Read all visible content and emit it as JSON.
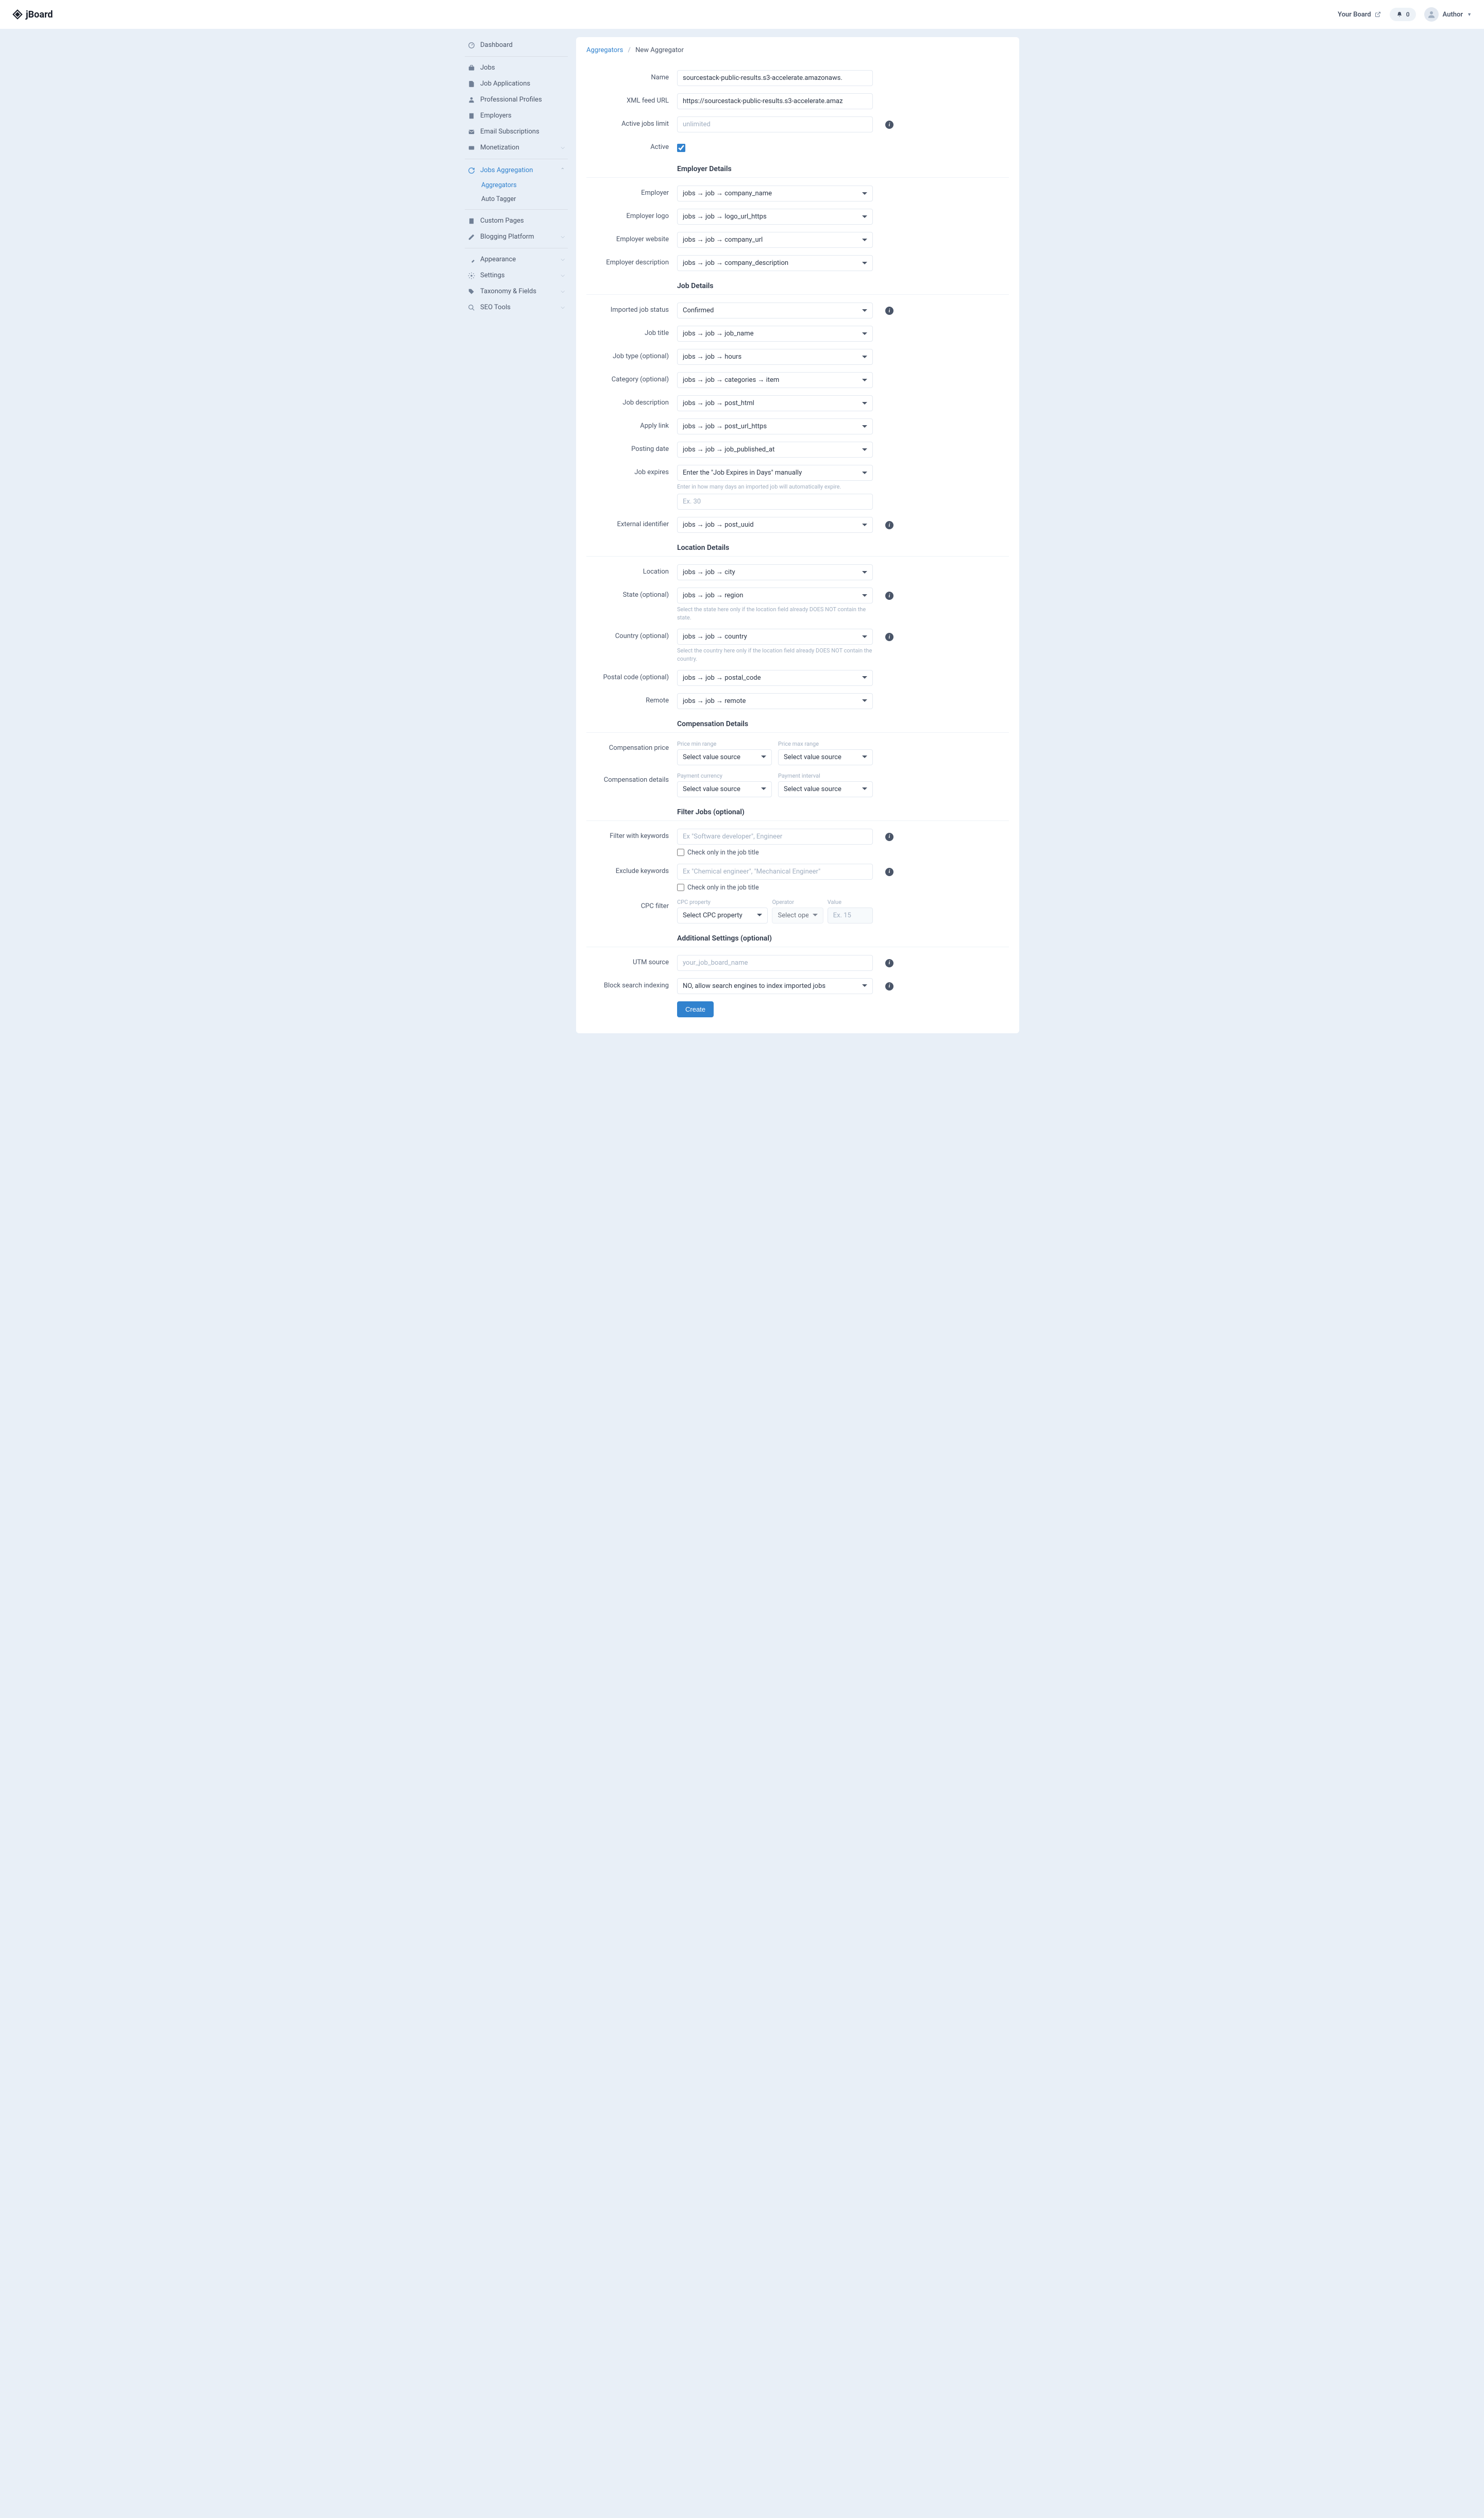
{
  "header": {
    "brand": "jBoard",
    "your_board": "Your Board",
    "notif_count": "0",
    "user_name": "Author"
  },
  "sidebar": {
    "dashboard": "Dashboard",
    "jobs": "Jobs",
    "job_applications": "Job Applications",
    "professional_profiles": "Professional Profiles",
    "employers": "Employers",
    "email_subscriptions": "Email Subscriptions",
    "monetization": "Monetization",
    "jobs_aggregation": "Jobs Aggregation",
    "aggregators": "Aggregators",
    "auto_tagger": "Auto Tagger",
    "custom_pages": "Custom Pages",
    "blogging_platform": "Blogging Platform",
    "appearance": "Appearance",
    "settings": "Settings",
    "taxonomy_fields": "Taxonomy & Fields",
    "seo_tools": "SEO Tools"
  },
  "breadcrumb": {
    "aggregators": "Aggregators",
    "new": "New Aggregator"
  },
  "form": {
    "name_label": "Name",
    "name_value": "sourcestack-public-results.s3-accelerate.amazonaws.",
    "xml_label": "XML feed URL",
    "xml_value": "https://sourcestack-public-results.s3-accelerate.amaz",
    "active_limit_label": "Active jobs limit",
    "active_limit_placeholder": "unlimited",
    "active_label": "Active",
    "employer_details": "Employer Details",
    "employer_label": "Employer",
    "employer_value": "jobs → job → company_name",
    "employer_logo_label": "Employer logo",
    "employer_logo_value": "jobs → job → logo_url_https",
    "employer_website_label": "Employer website",
    "employer_website_value": "jobs → job → company_url",
    "employer_desc_label": "Employer description",
    "employer_desc_value": "jobs → job → company_description",
    "job_details": "Job Details",
    "imported_status_label": "Imported job status",
    "imported_status_value": "Confirmed",
    "job_title_label": "Job title",
    "job_title_value": "jobs → job → job_name",
    "job_type_label": "Job type (optional)",
    "job_type_value": "jobs → job → hours",
    "category_label": "Category (optional)",
    "category_value": "jobs → job → categories → item",
    "job_desc_label": "Job description",
    "job_desc_value": "jobs → job → post_html",
    "apply_link_label": "Apply link",
    "apply_link_value": "jobs → job → post_url_https",
    "posting_date_label": "Posting date",
    "posting_date_value": "jobs → job → job_published_at",
    "job_expires_label": "Job expires",
    "job_expires_value": "Enter the \"Job Expires in Days\" manually",
    "job_expires_help": "Enter in how many days an imported job will automatically expire.",
    "job_expires_placeholder": "Ex. 30",
    "external_id_label": "External identifier",
    "external_id_value": "jobs → job → post_uuid",
    "location_details": "Location Details",
    "location_label": "Location",
    "location_value": "jobs → job → city",
    "state_label": "State (optional)",
    "state_value": "jobs → job → region",
    "state_help": "Select the state here only if the location field already DOES NOT contain the state.",
    "country_label": "Country (optional)",
    "country_value": "jobs → job → country",
    "country_help": "Select the country here only if the location field already DOES NOT contain the country.",
    "postal_label": "Postal code (optional)",
    "postal_value": "jobs → job → postal_code",
    "remote_label": "Remote",
    "remote_value": "jobs → job → remote",
    "compensation_details": "Compensation Details",
    "comp_price_label": "Compensation price",
    "price_min_label": "Price min range",
    "price_max_label": "Price max range",
    "comp_details_label": "Compensation details",
    "payment_currency_label": "Payment currency",
    "payment_interval_label": "Payment interval",
    "select_value_source": "Select value source",
    "filter_jobs": "Filter Jobs (optional)",
    "filter_keywords_label": "Filter with keywords",
    "filter_keywords_placeholder": "Ex \"Software developer\", Engineer",
    "check_title_only": "Check only in the job title",
    "exclude_keywords_label": "Exclude keywords",
    "exclude_keywords_placeholder": "Ex \"Chemical engineer\", \"Mechanical Engineer\"",
    "cpc_filter_label": "CPC filter",
    "cpc_property_label": "CPC property",
    "cpc_property_value": "Select CPC property",
    "operator_label": "Operator",
    "operator_value": "Select operator",
    "value_label": "Value",
    "value_placeholder": "Ex. 15",
    "additional_settings": "Additional Settings (optional)",
    "utm_label": "UTM source",
    "utm_placeholder": "your_job_board_name",
    "block_index_label": "Block search indexing",
    "block_index_value": "NO, allow search engines to index imported jobs",
    "create_btn": "Create"
  }
}
